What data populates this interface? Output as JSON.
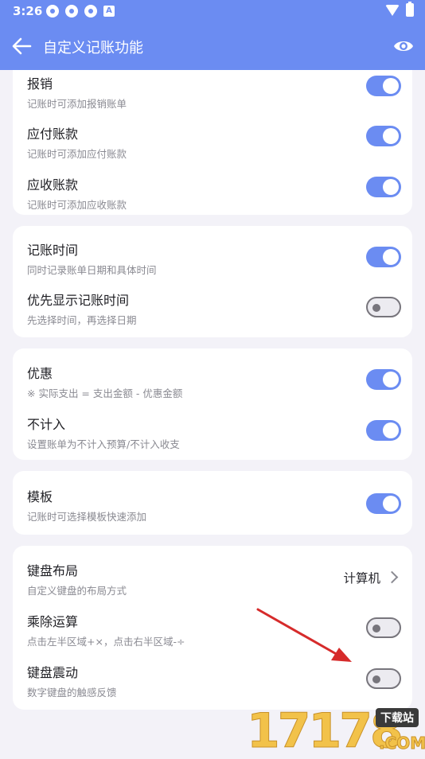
{
  "status_bar": {
    "time": "3:26",
    "notif_letter": "A"
  },
  "app_bar": {
    "title": "自定义记账功能"
  },
  "cards": [
    {
      "rows": [
        {
          "title": "报销",
          "subtitle": "记账时可添加报销账单",
          "on": true
        },
        {
          "title": "应付账款",
          "subtitle": "记账时可添加应付账款",
          "on": true
        },
        {
          "title": "应收账款",
          "subtitle": "记账时可添加应收账款",
          "on": true
        }
      ]
    },
    {
      "rows": [
        {
          "title": "记账时间",
          "subtitle": "同时记录账单日期和具体时间",
          "on": true
        },
        {
          "title": "优先显示记账时间",
          "subtitle": "先选择时间，再选择日期",
          "on": false
        }
      ]
    },
    {
      "rows": [
        {
          "title": "优惠",
          "subtitle": "※ 实际支出 = 支出金额 - 优惠金额",
          "on": true
        },
        {
          "title": "不计入",
          "subtitle": "设置账单为不计入预算/不计入收支",
          "on": true
        }
      ]
    },
    {
      "rows": [
        {
          "title": "模板",
          "subtitle": "记账时可选择模板快速添加",
          "on": true
        }
      ]
    },
    {
      "rows": [
        {
          "title": "键盘布局",
          "subtitle": "自定义键盘的布局方式",
          "value": "计算机"
        },
        {
          "title": "乘除运算",
          "subtitle": "点击左半区域+×，点击右半区域-÷",
          "on": false
        },
        {
          "title": "键盘震动",
          "subtitle": "数字键盘的触感反馈",
          "on": false
        }
      ]
    }
  ],
  "watermark": {
    "digits": "17178",
    "badge": "下载站",
    "domain": ".COM"
  },
  "colors": {
    "accent": "#6b8cf2",
    "background": "#f3f2f8",
    "card": "#ffffff",
    "arrow": "#d62b2b"
  }
}
